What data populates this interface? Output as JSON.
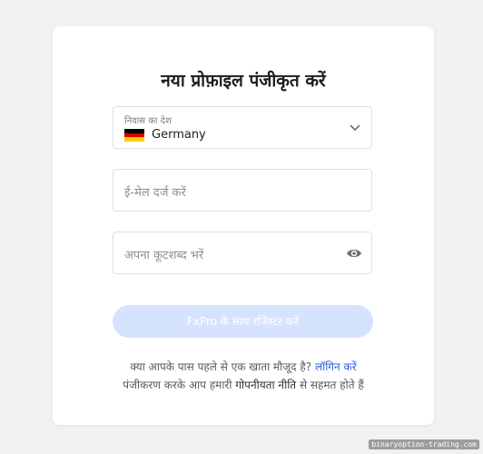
{
  "form": {
    "title": "नया प्रोफ़ाइल पंजीकृत करें",
    "country": {
      "label": "निवास का देश",
      "value": "Germany",
      "flag_icon": "germany-flag-icon",
      "flag_colors": [
        "#000000",
        "#dd0000",
        "#ffce00"
      ]
    },
    "email": {
      "placeholder": "ई-मेल दर्ज करें"
    },
    "password": {
      "placeholder": "अपना कूटशब्द भरें",
      "toggle_icon": "eye-icon"
    },
    "submit_label": "FxPro के साथ रजिस्टर करें",
    "login_prompt": "क्या आपके पास पहले से एक खाता मौजूद है?",
    "login_link": "लॉगिन करें",
    "terms_prefix": "पंजीकरण करके आप हमारी ",
    "terms_link": "गोपनीयता नीति",
    "terms_suffix": " से सहमत होते हैं"
  },
  "colors": {
    "accent": "#2a5bd7",
    "button_disabled": "#d6e3ff",
    "background": "#f1f1f3"
  },
  "watermark": "binaryoption-trading.com"
}
